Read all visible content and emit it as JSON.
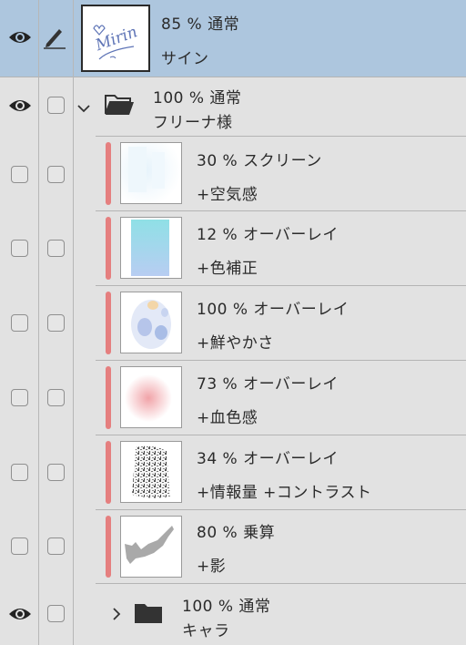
{
  "accent_color": "#e57f7f",
  "selected_color": "#adc6de",
  "layers": [
    {
      "kind": "layer",
      "top_text": "85 %  通常",
      "bottom_text": "サイン",
      "visible": true,
      "editing": true,
      "selected": true,
      "thumbnail": "mirin-signature",
      "thumbnail_text": "Mirin"
    },
    {
      "kind": "folder",
      "top_text": "100 %  通常",
      "bottom_text": "フリーナ様",
      "visible": true,
      "expanded": true
    },
    {
      "kind": "layer",
      "top_text": "30 %  スクリーン",
      "bottom_text": "+空気感",
      "visible": false,
      "clipped": true,
      "thumbnail": "pale-blue-light"
    },
    {
      "kind": "layer",
      "top_text": "12 %  オーバーレイ",
      "bottom_text": "+色補正",
      "visible": false,
      "clipped": true,
      "thumbnail": "cyan-gradient"
    },
    {
      "kind": "layer",
      "top_text": "100 %  オーバーレイ",
      "bottom_text": "+鮮やかさ",
      "visible": false,
      "clipped": true,
      "thumbnail": "blue-blobs"
    },
    {
      "kind": "layer",
      "top_text": "73 %  オーバーレイ",
      "bottom_text": "+血色感",
      "visible": false,
      "clipped": true,
      "thumbnail": "pink-blush"
    },
    {
      "kind": "layer",
      "top_text": "34 %  オーバーレイ",
      "bottom_text": "+情報量 +コントラスト",
      "visible": false,
      "clipped": true,
      "thumbnail": "noise-texture"
    },
    {
      "kind": "layer",
      "top_text": "80 %  乗算",
      "bottom_text": "+影",
      "visible": false,
      "clipped": true,
      "thumbnail": "gray-shadow"
    },
    {
      "kind": "folder",
      "top_text": "100 %  通常",
      "bottom_text": "キャラ",
      "visible": true,
      "expanded": false
    }
  ]
}
